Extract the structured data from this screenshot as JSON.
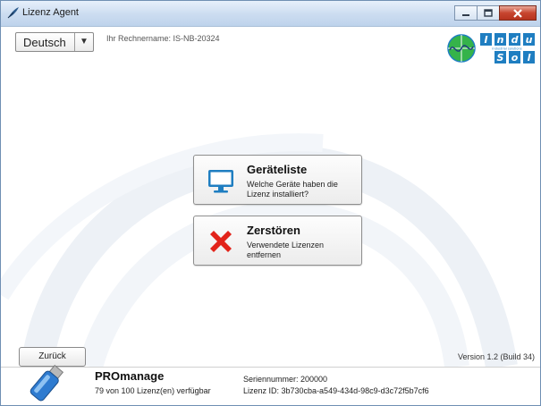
{
  "window": {
    "title": "Lizenz Agent",
    "icon": "feather-icon",
    "controls": [
      "minimize-icon",
      "maximize-icon",
      "close-icon"
    ]
  },
  "header": {
    "language": {
      "selected": "Deutsch",
      "arrow": "▼"
    },
    "computer_name": "Ihr Rechnername: IS-NB-20324",
    "logo": {
      "letters": [
        "I",
        "n",
        "d",
        "u",
        "S",
        "o",
        "l"
      ],
      "tagline": "industrial solutions"
    }
  },
  "actions": [
    {
      "title": "Geräteliste",
      "description": "Welche Geräte haben die Lizenz installiert?",
      "icon": "monitor-icon"
    },
    {
      "title": "Zerstören",
      "description": "Verwendete Lizenzen entfernen",
      "icon": "red-x-icon"
    }
  ],
  "navigation": {
    "back_label": "Zurück"
  },
  "version": "Version 1.2 (Build 34)",
  "footer": {
    "icon": "usb-stick-icon",
    "product_name": "PROmanage",
    "license_count": "79 von 100 Lizenz(en) verfügbar",
    "serial_number": "Seriennummer: 200000",
    "license_id": "Lizenz ID: 3b730cba-a549-434d-98c9-d3c72f5b7cf6"
  },
  "colors": {
    "accent_blue": "#1f7ec1",
    "logo_green": "#35b34a",
    "destroy_red": "#e2231a"
  }
}
